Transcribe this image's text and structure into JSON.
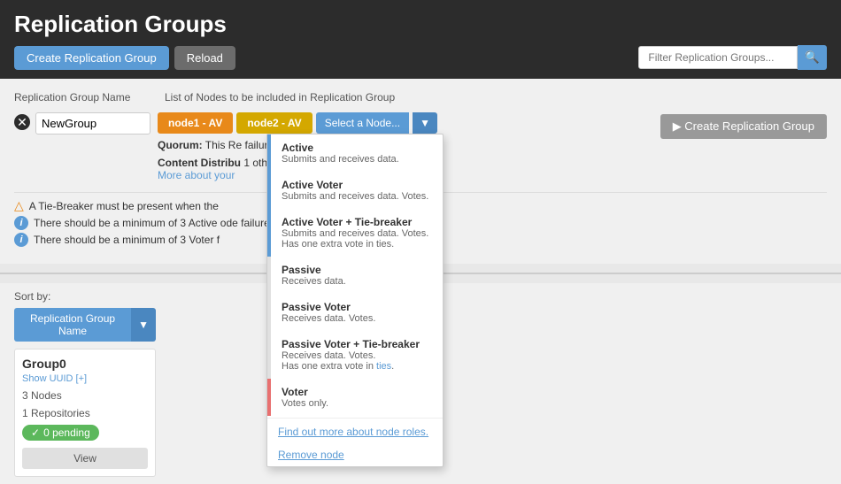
{
  "header": {
    "title": "Replication Groups",
    "create_button": "Create Replication Group",
    "reload_button": "Reload",
    "search_placeholder": "Filter Replication Groups..."
  },
  "table": {
    "col_name": "Replication Group Name",
    "col_nodes": "List of Nodes to be included in Replication Group"
  },
  "new_group": {
    "name_placeholder": "NewGroup",
    "node1_label": "node1 - AV",
    "node2_label": "node2 - AV",
    "select_node_label": "Select a Node...",
    "create_button": "Create Replication Group",
    "quorum_label": "Quorum:",
    "quorum_text": "This Re",
    "quorum_suffix": "failures.",
    "content_dist_label": "Content Distribu",
    "content_dist_suffix": "1 other Active/Passive available.",
    "more_about_link": "More about your",
    "info1": "A Tie-Breaker must be present when the",
    "info2": "There should be a minimum of 3 Active",
    "info2_suffix": "ode failure.",
    "info3": "There should be a minimum of 3 Voter f"
  },
  "dropdown": {
    "items": [
      {
        "title": "Active",
        "subtitle": "Submits and receives data.",
        "border_color": "#5b9bd5",
        "type": "active"
      },
      {
        "title": "Active Voter",
        "subtitle": "Submits and receives data. Votes.",
        "border_color": "#5b9bd5",
        "type": "active-voter"
      },
      {
        "title": "Active Voter + Tie-breaker",
        "subtitle_line1": "Submits and receives data. Votes.",
        "subtitle_line2": "Has one extra vote in ties.",
        "border_color": "#5b9bd5",
        "type": "av-tiebreaker"
      },
      {
        "title": "Passive",
        "subtitle": "Receives data.",
        "border_color": "#aaa",
        "type": "passive"
      },
      {
        "title": "Passive Voter",
        "subtitle": "Receives data. Votes.",
        "border_color": "#aaa",
        "type": "passive-voter"
      },
      {
        "title": "Passive Voter + Tie-breaker",
        "subtitle_line1": "Receives data. Votes.",
        "subtitle_line2": "Has one extra vote in ties.",
        "border_color": "#aaa",
        "type": "pv-tiebreaker"
      },
      {
        "title": "Voter",
        "subtitle": "Votes only.",
        "border_color": "#e87070",
        "type": "voter"
      }
    ],
    "find_out_link": "Find out more about node roles.",
    "remove_node": "Remove node"
  },
  "bottom": {
    "sort_label": "Sort by:",
    "sort_button": "Replication Group Name",
    "group": {
      "name": "Group0",
      "show_uuid": "Show UUID [+]",
      "nodes": "3 Nodes",
      "repositories": "1 Repositories",
      "pending_badge": "0 pending",
      "view_button": "View"
    }
  }
}
